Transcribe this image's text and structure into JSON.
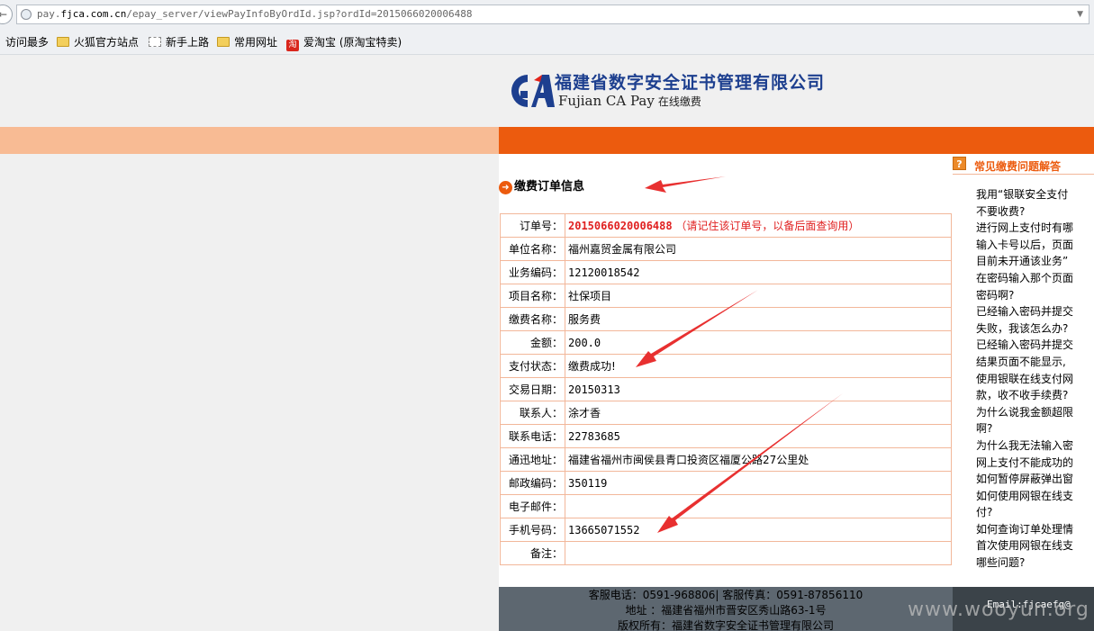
{
  "browser": {
    "url_prefix": "pay.",
    "url_domain": "fjca.com.cn",
    "url_path": "/epay_server/viewPayInfoByOrdId.jsp?ordId=2015066020006488",
    "bookmarks": [
      {
        "label": "访问最多",
        "icon": "none"
      },
      {
        "label": "火狐官方站点",
        "icon": "folder-icon"
      },
      {
        "label": "新手上路",
        "icon": "page-icon"
      },
      {
        "label": "常用网址",
        "icon": "folder-icon"
      },
      {
        "label": "爱淘宝 (原淘宝特卖)",
        "icon": "taobao-icon",
        "icon_text": "淘"
      }
    ]
  },
  "header": {
    "company_cn": "福建省数字安全证书管理有限公司",
    "company_en": "Fujian CA Pay",
    "tagline": "在线缴费",
    "colors": {
      "accent": "#ec5b0e",
      "band_light": "#f8bb94",
      "logo_blue": "#1d3f8f"
    }
  },
  "main": {
    "section_title": "缴费订单信息",
    "rows": [
      {
        "label": "订单号：",
        "value": "2015066020006488",
        "note": "（请记住该订单号，以备后面查询用）"
      },
      {
        "label": "单位名称：",
        "value": "福州嘉贸金属有限公司"
      },
      {
        "label": "业务编码：",
        "value": "12120018542"
      },
      {
        "label": "项目名称：",
        "value": "社保项目"
      },
      {
        "label": "缴费名称：",
        "value": "服务费"
      },
      {
        "label": "金额：",
        "value": "200.0"
      },
      {
        "label": "支付状态：",
        "value": "缴费成功!"
      },
      {
        "label": "交易日期：",
        "value": "20150313"
      },
      {
        "label": "联系人：",
        "value": "涂才香"
      },
      {
        "label": "联系电话：",
        "value": "22783685"
      },
      {
        "label": "通迅地址：",
        "value": "福建省福州市闽侯县青口投资区福厦公路27公里处"
      },
      {
        "label": "邮政编码：",
        "value": "350119"
      },
      {
        "label": "电子邮件：",
        "value": ""
      },
      {
        "label": "手机号码：",
        "value": "13665071552"
      },
      {
        "label": "备注：",
        "value": ""
      }
    ]
  },
  "sidebar": {
    "title": "常见缴费问题解答",
    "faq_lines": [
      {
        "text": "我用“银联安全支付",
        "bullet": true
      },
      {
        "text": "不要收费?",
        "bullet": false
      },
      {
        "text": "进行网上支付时有哪",
        "bullet": true
      },
      {
        "text": "输入卡号以后，页面",
        "bullet": true
      },
      {
        "text": "目前未开通该业务”",
        "bullet": false
      },
      {
        "text": "在密码输入那个页面",
        "bullet": true
      },
      {
        "text": "密码啊?",
        "bullet": false
      },
      {
        "text": "已经输入密码并提交",
        "bullet": true
      },
      {
        "text": "失败，我该怎么办?",
        "bullet": false
      },
      {
        "text": "已经输入密码并提交",
        "bullet": true
      },
      {
        "text": "结果页面不能显示,",
        "bullet": false
      },
      {
        "text": "使用银联在线支付网",
        "bullet": true
      },
      {
        "text": "款，收不收手续费?",
        "bullet": false
      },
      {
        "text": "为什么说我金额超限",
        "bullet": true
      },
      {
        "text": "啊?",
        "bullet": false
      },
      {
        "text": "为什么我无法输入密",
        "bullet": true
      },
      {
        "text": "网上支付不能成功的",
        "bullet": true
      },
      {
        "text": "如何暂停屏蔽弹出窗",
        "bullet": true
      },
      {
        "text": "如何使用网银在线支",
        "bullet": true
      },
      {
        "text": "付?",
        "bullet": false
      },
      {
        "text": "如何查询订单处理情",
        "bullet": true
      },
      {
        "text": "首次使用网银在线支",
        "bullet": true
      },
      {
        "text": "哪些问题?",
        "bullet": false
      }
    ]
  },
  "footer": {
    "line1": "客服电话：0591-968806| 客服传真：0591-87856110",
    "line2": "地址 ：福建省福州市晋安区秀山路63-1号",
    "line3": "版权所有：福建省数字安全证书管理有限公司",
    "email": "Email:fjcaefg@",
    "watermark": "www.wooyun.org"
  }
}
